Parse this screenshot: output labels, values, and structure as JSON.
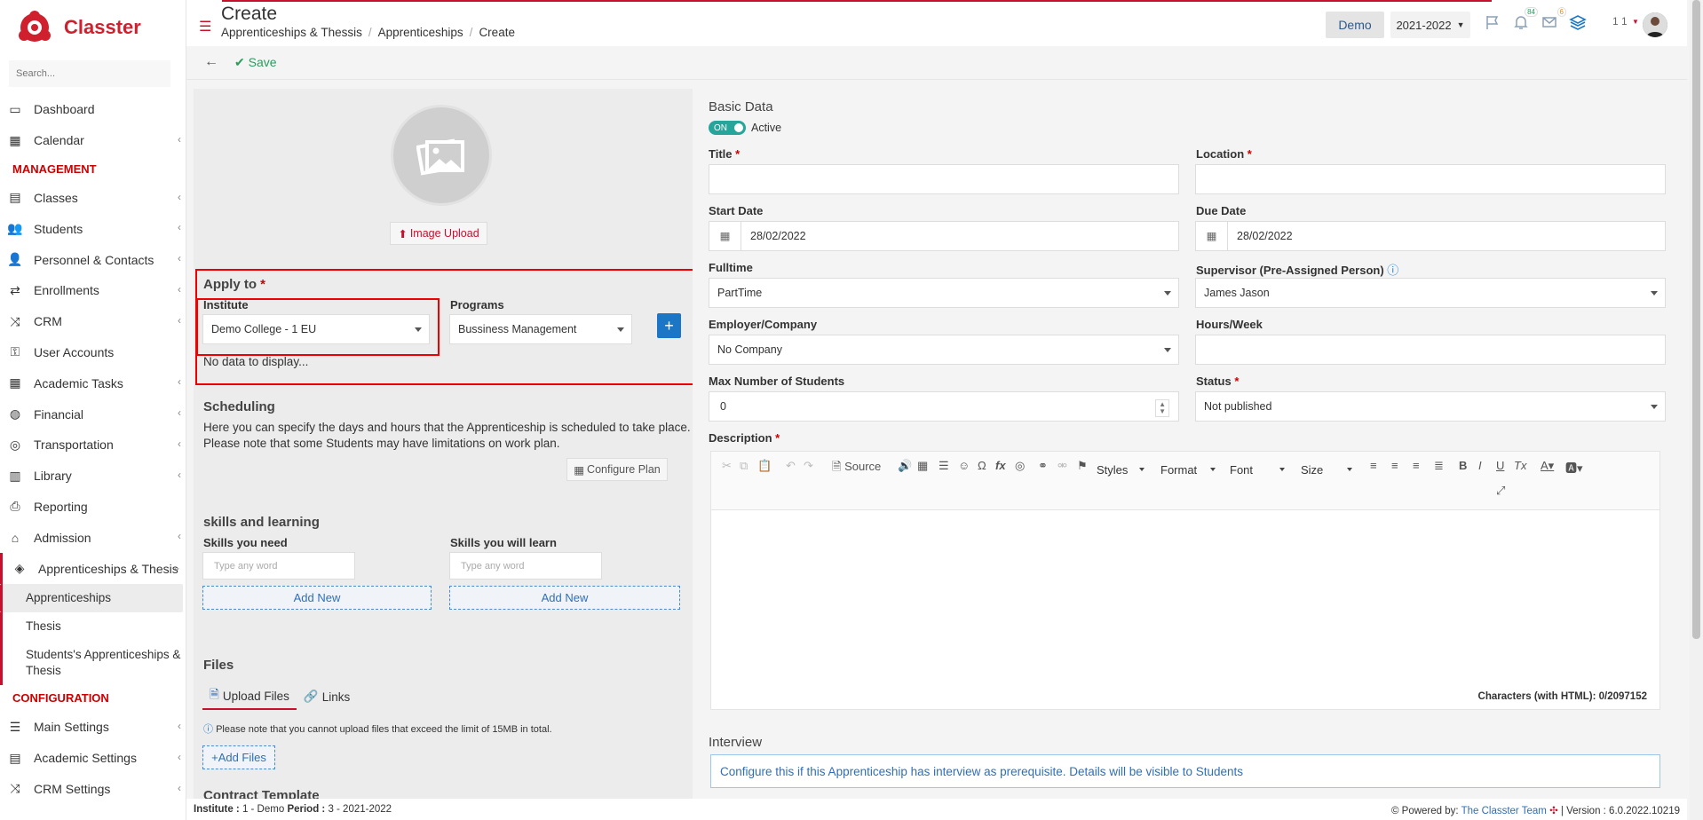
{
  "brand": {
    "name": "Classter",
    "accent": "#c8102e"
  },
  "sidebar": {
    "search_placeholder": "Search...",
    "items_top": [
      {
        "label": "Dashboard",
        "icon": "laptop-icon",
        "chevron": false
      },
      {
        "label": "Calendar",
        "icon": "calendar-icon",
        "chevron": true
      }
    ],
    "management_label": "MANAGEMENT",
    "management_items": [
      {
        "label": "Classes",
        "icon": "classes-icon",
        "chevron": true
      },
      {
        "label": "Students",
        "icon": "students-icon",
        "chevron": true
      },
      {
        "label": "Personnel & Contacts",
        "icon": "contacts-icon",
        "chevron": true
      },
      {
        "label": "Enrollments",
        "icon": "exchange-icon",
        "chevron": true
      },
      {
        "label": "CRM",
        "icon": "crm-icon",
        "chevron": true
      },
      {
        "label": "User Accounts",
        "icon": "key-icon",
        "chevron": false
      },
      {
        "label": "Academic Tasks",
        "icon": "tasks-icon",
        "chevron": true
      },
      {
        "label": "Financial",
        "icon": "coins-icon",
        "chevron": true
      },
      {
        "label": "Transportation",
        "icon": "bus-icon",
        "chevron": true
      },
      {
        "label": "Library",
        "icon": "library-icon",
        "chevron": true
      },
      {
        "label": "Reporting",
        "icon": "print-icon",
        "chevron": false
      },
      {
        "label": "Admission",
        "icon": "bank-icon",
        "chevron": true
      }
    ],
    "active_parent": {
      "label": "Apprenticeships & Thesis",
      "icon": "box-icon"
    },
    "sub_items": [
      {
        "label": "Apprenticeships",
        "active": true
      },
      {
        "label": "Thesis",
        "active": false
      },
      {
        "label": "Students's Apprenticeships & Thesis",
        "active": false
      }
    ],
    "configuration_label": "CONFIGURATION",
    "config_items": [
      {
        "label": "Main Settings",
        "icon": "sliders-icon",
        "chevron": true
      },
      {
        "label": "Academic Settings",
        "icon": "classes-icon",
        "chevron": true
      },
      {
        "label": "CRM Settings",
        "icon": "crm-icon",
        "chevron": true
      }
    ]
  },
  "header": {
    "title": "Create",
    "breadcrumbs": [
      "Apprenticeships & Thessis",
      "Apprenticeships",
      "Create"
    ],
    "demo": "Demo",
    "year": "2021-2022",
    "notif_count": "84",
    "mail_count": "6",
    "user_count": "1 1"
  },
  "toolbar": {
    "save": "Save"
  },
  "left": {
    "image_upload": "Image Upload",
    "apply_to": "Apply to",
    "institute_label": "Institute",
    "institute_value": "Demo College - 1 EU",
    "programs_label": "Programs",
    "programs_value": "Bussiness Management",
    "add_symbol": "+",
    "no_data": "No data to display...",
    "scheduling_title": "Scheduling",
    "scheduling_text_1": "Here you can specify the days and hours that the Apprenticeship is scheduled to take place.",
    "scheduling_text_2": "Please note that some Students may have limitations on work plan.",
    "configure_plan": "Configure Plan",
    "skills_title": "skills and learning",
    "skills_need_label": "Skills you need",
    "skills_learn_label": "Skills you will learn",
    "word_placeholder": "Type any word",
    "add_new": "Add New",
    "files_title": "Files",
    "tab_upload": "Upload Files",
    "tab_links": "Links",
    "files_note": "Please note that you cannot upload files that exceed the limit of 15MB in total.",
    "add_files": "Add Files",
    "contract_title": "Contract Template"
  },
  "right": {
    "basic_data": "Basic Data",
    "toggle_on": "ON",
    "active_label": "Active",
    "title_label": "Title",
    "location_label": "Location",
    "start_date_label": "Start Date",
    "start_date": "28/02/2022",
    "due_date_label": "Due Date",
    "due_date": "28/02/2022",
    "fulltime_label": "Fulltime",
    "fulltime_value": "PartTime",
    "supervisor_label": "Supervisor (Pre-Assigned Person)",
    "supervisor_value": "James Jason",
    "employer_label": "Employer/Company",
    "employer_value": "No Company",
    "hours_label": "Hours/Week",
    "max_students_label": "Max Number of Students",
    "max_students_value": "0",
    "status_label": "Status",
    "status_value": "Not published",
    "description_label": "Description",
    "editor": {
      "source": "Source",
      "styles": "Styles",
      "format": "Format",
      "font": "Font",
      "size": "Size",
      "counter": "Characters (with HTML): 0/2097152"
    },
    "interview_title": "Interview",
    "interview_text": "Configure this if this Apprenticeship has interview as prerequisite. Details will be visible to Students"
  },
  "footer": {
    "institute_label": "Institute :",
    "institute_value": " 1 - Demo ",
    "period_label": "Period :",
    "period_value": " 3 - 2021-2022",
    "powered": "Powered by: ",
    "team": "The Classter Team",
    "version": "| Version : 6.0.2022.10219"
  }
}
